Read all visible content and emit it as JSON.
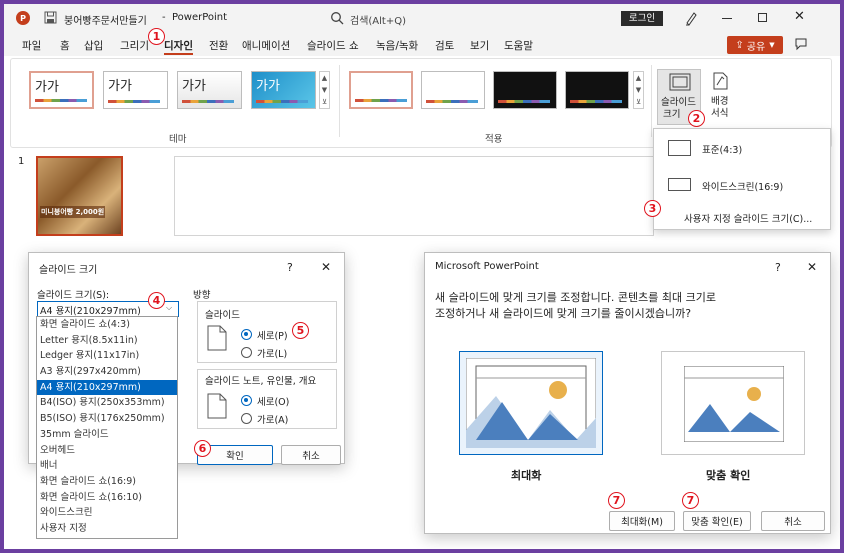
{
  "ppt": {
    "file_title": "붕어빵주문서만들기",
    "app_sep": "-",
    "app_name": "PowerPoint",
    "search_placeholder": "검색(Alt+Q)",
    "login": "로그인",
    "share": "공유",
    "tabs": [
      "파일",
      "홈",
      "삽입",
      "그리기",
      "디자인",
      "전환",
      "애니메이션",
      "슬라이드 쇼",
      "녹음/녹화",
      "검토",
      "보기",
      "도움말"
    ],
    "theme_sample": "가가",
    "group_theme": "테마",
    "group_variant": "적용",
    "slide_size_label": [
      "슬라이드",
      "크기"
    ],
    "bg_format_label": [
      "배경",
      "서식"
    ],
    "slide_number": "1",
    "slide_thumb_text": "미니붕어빵 2,000원",
    "dropdown": {
      "standard": "표준(4:3)",
      "widescreen": "와이드스크린(16:9)",
      "custom": "사용자 지정 슬라이드 크기(C)..."
    }
  },
  "markers": [
    "1",
    "2",
    "3",
    "4",
    "5",
    "6",
    "7",
    "7"
  ],
  "slide_size_dialog": {
    "title": "슬라이드 크기",
    "help": "?",
    "close": "✕",
    "size_label": "슬라이드 크기(S):",
    "selected": "A4 용지(210x297mm)",
    "options": [
      "화면 슬라이드 쇼(4:3)",
      "Letter 용지(8.5x11in)",
      "Ledger 용지(11x17in)",
      "A3 용지(297x420mm)",
      "A4 용지(210x297mm)",
      "B4(ISO) 용지(250x353mm)",
      "B5(ISO) 용지(176x250mm)",
      "35mm 슬라이드",
      "오버헤드",
      "배너",
      "화면 슬라이드 쇼(16:9)",
      "화면 슬라이드 쇼(16:10)",
      "와이드스크린",
      "사용자 지정"
    ],
    "orientation_label": "방향",
    "slides_label": "슬라이드",
    "portrait": "세로(P)",
    "landscape": "가로(L)",
    "notes_label": "슬라이드 노트, 유인물, 개요",
    "notes_portrait": "세로(O)",
    "notes_landscape": "가로(A)",
    "ok": "확인",
    "cancel": "취소"
  },
  "scale_dialog": {
    "title": "Microsoft PowerPoint",
    "help": "?",
    "close": "✕",
    "message_line1": "새 슬라이드에 맞게 크기를 조정합니다. 콘텐츠를 최대 크기로",
    "message_line2": "조정하거나 새 슬라이드에 맞게 크기를 줄이시겠습니까?",
    "maximize_label": "최대화",
    "fit_label": "맞춤 확인",
    "maximize_btn": "최대화(M)",
    "fit_btn": "맞춤 확인(E)",
    "cancel": "취소"
  }
}
